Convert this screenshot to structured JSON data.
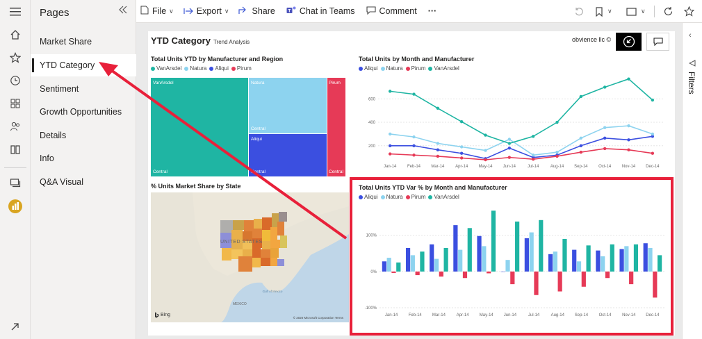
{
  "rail": {
    "icons": [
      "hamburger-icon",
      "home-icon",
      "star-icon",
      "clock-icon",
      "apps-icon",
      "people-icon",
      "book-icon",
      "workspaces-icon",
      "powerbi-icon",
      "expand-icon"
    ]
  },
  "pages_pane": {
    "title": "Pages",
    "items": [
      {
        "label": "Market Share",
        "active": false
      },
      {
        "label": "YTD Category",
        "active": true
      },
      {
        "label": "Sentiment",
        "active": false
      },
      {
        "label": "Growth Opportunities",
        "active": false
      },
      {
        "label": "Details",
        "active": false
      },
      {
        "label": "Info",
        "active": false
      },
      {
        "label": "Q&A Visual",
        "active": false
      }
    ]
  },
  "toolbar": {
    "file": "File",
    "export": "Export",
    "share": "Share",
    "chat": "Chat in Teams",
    "comment": "Comment",
    "more": "···"
  },
  "filters": {
    "label": "Filters"
  },
  "report": {
    "title": "YTD Category",
    "subtitle": "Trend Analysis",
    "company": "obvience llc ©"
  },
  "colors": {
    "VanArsdel": "#1fb5a3",
    "Natura": "#8dd3ef",
    "Aliqui": "#3b4fe0",
    "Pirum": "#e63a57",
    "highlight": "#e8203a",
    "arrow": "#e8203a"
  },
  "treemap": {
    "title": "Total Units YTD by Manufacturer and Region",
    "legend": [
      "VanArsdel",
      "Natura",
      "Aliqui",
      "Pirum"
    ],
    "tiles": [
      {
        "name": "VanArsdel",
        "sub": "Central"
      },
      {
        "name": "Natura",
        "sub": "Central"
      },
      {
        "name": "Aliqui",
        "sub": "Central"
      },
      {
        "name": "Pirum",
        "sub": "Central"
      }
    ]
  },
  "map": {
    "title": "% Units Market Share by State",
    "country_label": "UNITED STATES",
    "mexico_label": "MEXICO",
    "gulf_label": "Gulf of Mexico",
    "bing": "Bing",
    "copyright": "© 2020 Microsoft Corporation Terms"
  },
  "chart_data": [
    {
      "type": "line",
      "title": "Total Units by Month and Manufacturer",
      "categories": [
        "Jan-14",
        "Feb-14",
        "Mar-14",
        "Apr-14",
        "May-14",
        "Jun-14",
        "Jul-14",
        "Aug-14",
        "Sep-14",
        "Oct-14",
        "Nov-14",
        "Dec-14"
      ],
      "yticks": [
        200,
        400,
        600
      ],
      "ylim": [
        80,
        780
      ],
      "legend": [
        "Aliqui",
        "Natura",
        "Pirum",
        "VanArsdel"
      ],
      "series": [
        {
          "name": "Aliqui",
          "values": [
            200,
            200,
            165,
            135,
            90,
            180,
            100,
            120,
            200,
            265,
            250,
            280
          ]
        },
        {
          "name": "Natura",
          "values": [
            300,
            275,
            220,
            190,
            160,
            255,
            120,
            145,
            265,
            355,
            370,
            300
          ]
        },
        {
          "name": "Pirum",
          "values": [
            130,
            120,
            110,
            95,
            80,
            100,
            85,
            110,
            145,
            175,
            165,
            135
          ]
        },
        {
          "name": "VanArsdel",
          "values": [
            665,
            640,
            520,
            405,
            290,
            220,
            280,
            400,
            620,
            700,
            770,
            590
          ]
        }
      ]
    },
    {
      "type": "bar",
      "title": "Total Units YTD Var % by Month and Manufacturer",
      "categories": [
        "Jan-14",
        "Feb-14",
        "Mar-14",
        "Apr-14",
        "May-14",
        "Jun-14",
        "Jul-14",
        "Aug-14",
        "Sep-14",
        "Oct-14",
        "Nov-14",
        "Dec-14"
      ],
      "yticks": [
        -100,
        0,
        100
      ],
      "ylim": [
        -100,
        180
      ],
      "legend": [
        "Aliqui",
        "Natura",
        "Pirum",
        "VanArsdel"
      ],
      "series": [
        {
          "name": "Aliqui",
          "values": [
            28,
            65,
            75,
            128,
            98,
            0,
            92,
            48,
            60,
            58,
            62,
            78
          ]
        },
        {
          "name": "Natura",
          "values": [
            38,
            45,
            35,
            60,
            70,
            32,
            108,
            55,
            28,
            42,
            70,
            65
          ]
        },
        {
          "name": "Pirum",
          "values": [
            -4,
            -10,
            -14,
            -18,
            -5,
            -35,
            -65,
            -55,
            -42,
            -18,
            -35,
            -72
          ]
        },
        {
          "name": "VanArsdel",
          "values": [
            25,
            55,
            65,
            120,
            168,
            138,
            142,
            90,
            72,
            75,
            75,
            45
          ]
        }
      ]
    }
  ]
}
